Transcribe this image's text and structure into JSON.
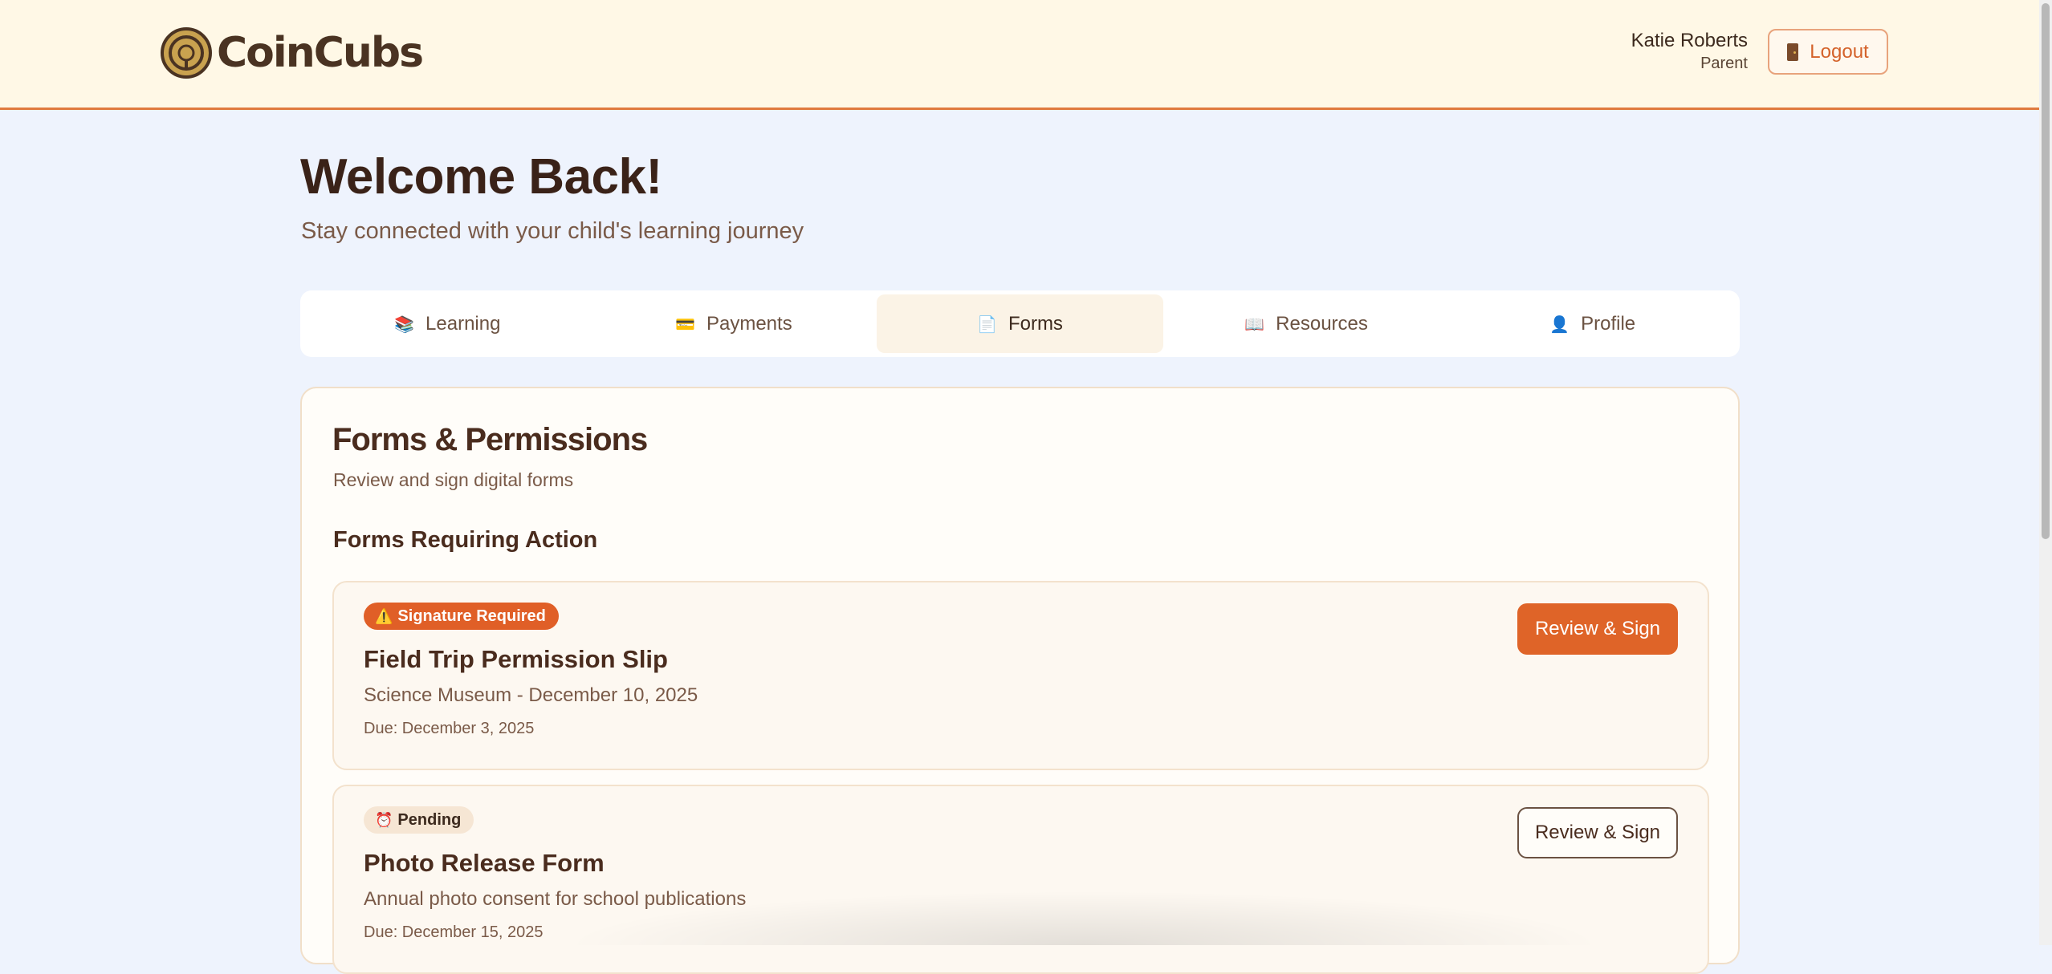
{
  "app": {
    "name": "CoinCubs"
  },
  "user": {
    "name": "Katie Roberts",
    "role": "Parent",
    "logout_label": "Logout"
  },
  "welcome": {
    "title": "Welcome Back!",
    "subtitle": "Stay connected with your child's learning journey"
  },
  "tabs": [
    {
      "label": "Learning",
      "icon": "📚",
      "active": false
    },
    {
      "label": "Payments",
      "icon": "💳",
      "active": false
    },
    {
      "label": "Forms",
      "icon": "📄",
      "active": true
    },
    {
      "label": "Resources",
      "icon": "📖",
      "active": false
    },
    {
      "label": "Profile",
      "icon": "👤",
      "active": false
    }
  ],
  "forms_section": {
    "title": "Forms & Permissions",
    "subtitle": "Review and sign digital forms",
    "action_heading": "Forms Requiring Action",
    "items": [
      {
        "badge_icon": "⚠️",
        "badge": "Signature Required",
        "title": "Field Trip Permission Slip",
        "description": "Science Museum - December 10, 2025",
        "due": "Due: December 3, 2025",
        "button": "Review & Sign"
      },
      {
        "badge_icon": "⏰",
        "badge": "Pending",
        "title": "Photo Release Form",
        "description": "Annual photo consent for school publications",
        "due": "Due: December 15, 2025",
        "button": "Review & Sign"
      }
    ]
  },
  "colors": {
    "accent": "#df6428",
    "header_bg": "#fff8e6",
    "page_bg": "#eef3fd"
  }
}
